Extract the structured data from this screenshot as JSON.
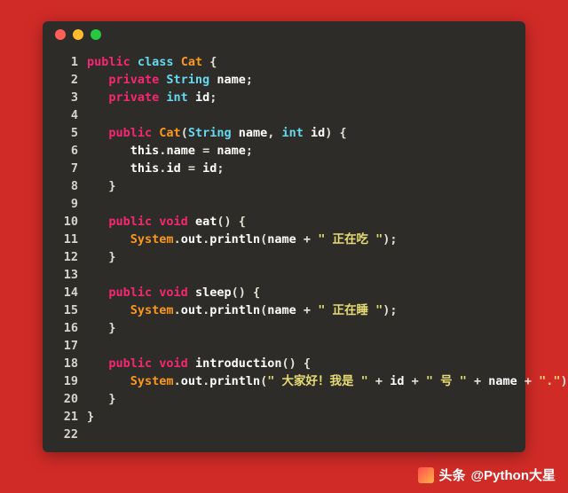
{
  "window": {
    "dots": [
      "red",
      "yellow",
      "green"
    ]
  },
  "code": {
    "lines": [
      [
        {
          "t": "kw",
          "v": "public "
        },
        {
          "t": "type",
          "v": "class "
        },
        {
          "t": "name",
          "v": "Cat "
        },
        {
          "t": "punc",
          "v": "{"
        }
      ],
      [
        {
          "t": "punc",
          "v": "   "
        },
        {
          "t": "kw",
          "v": "private "
        },
        {
          "t": "type",
          "v": "String "
        },
        {
          "t": "id",
          "v": "name"
        },
        {
          "t": "punc",
          "v": ";"
        }
      ],
      [
        {
          "t": "punc",
          "v": "   "
        },
        {
          "t": "kw",
          "v": "private "
        },
        {
          "t": "type",
          "v": "int "
        },
        {
          "t": "id",
          "v": "id"
        },
        {
          "t": "punc",
          "v": ";"
        }
      ],
      [],
      [
        {
          "t": "punc",
          "v": "   "
        },
        {
          "t": "kw",
          "v": "public "
        },
        {
          "t": "name",
          "v": "Cat"
        },
        {
          "t": "punc",
          "v": "("
        },
        {
          "t": "type",
          "v": "String "
        },
        {
          "t": "id",
          "v": "name"
        },
        {
          "t": "punc",
          "v": ", "
        },
        {
          "t": "type",
          "v": "int "
        },
        {
          "t": "id",
          "v": "id"
        },
        {
          "t": "punc",
          "v": ") {"
        }
      ],
      [
        {
          "t": "punc",
          "v": "      "
        },
        {
          "t": "id",
          "v": "this"
        },
        {
          "t": "punc",
          "v": "."
        },
        {
          "t": "id",
          "v": "name"
        },
        {
          "t": "punc",
          "v": " = "
        },
        {
          "t": "id",
          "v": "name"
        },
        {
          "t": "punc",
          "v": ";"
        }
      ],
      [
        {
          "t": "punc",
          "v": "      "
        },
        {
          "t": "id",
          "v": "this"
        },
        {
          "t": "punc",
          "v": "."
        },
        {
          "t": "id",
          "v": "id"
        },
        {
          "t": "punc",
          "v": " = "
        },
        {
          "t": "id",
          "v": "id"
        },
        {
          "t": "punc",
          "v": ";"
        }
      ],
      [
        {
          "t": "punc",
          "v": "   }"
        }
      ],
      [],
      [
        {
          "t": "punc",
          "v": "   "
        },
        {
          "t": "kw",
          "v": "public "
        },
        {
          "t": "kw",
          "v": "void "
        },
        {
          "t": "id",
          "v": "eat"
        },
        {
          "t": "punc",
          "v": "() {"
        }
      ],
      [
        {
          "t": "punc",
          "v": "      "
        },
        {
          "t": "name",
          "v": "System"
        },
        {
          "t": "punc",
          "v": "."
        },
        {
          "t": "id",
          "v": "out"
        },
        {
          "t": "punc",
          "v": "."
        },
        {
          "t": "id",
          "v": "println"
        },
        {
          "t": "punc",
          "v": "("
        },
        {
          "t": "id",
          "v": "name"
        },
        {
          "t": "punc",
          "v": " + "
        },
        {
          "t": "str",
          "v": "\" 正在吃 \""
        },
        {
          "t": "punc",
          "v": ");"
        }
      ],
      [
        {
          "t": "punc",
          "v": "   }"
        }
      ],
      [],
      [
        {
          "t": "punc",
          "v": "   "
        },
        {
          "t": "kw",
          "v": "public "
        },
        {
          "t": "kw",
          "v": "void "
        },
        {
          "t": "id",
          "v": "sleep"
        },
        {
          "t": "punc",
          "v": "() {"
        }
      ],
      [
        {
          "t": "punc",
          "v": "      "
        },
        {
          "t": "name",
          "v": "System"
        },
        {
          "t": "punc",
          "v": "."
        },
        {
          "t": "id",
          "v": "out"
        },
        {
          "t": "punc",
          "v": "."
        },
        {
          "t": "id",
          "v": "println"
        },
        {
          "t": "punc",
          "v": "("
        },
        {
          "t": "id",
          "v": "name"
        },
        {
          "t": "punc",
          "v": " + "
        },
        {
          "t": "str",
          "v": "\" 正在睡 \""
        },
        {
          "t": "punc",
          "v": ");"
        }
      ],
      [
        {
          "t": "punc",
          "v": "   }"
        }
      ],
      [],
      [
        {
          "t": "punc",
          "v": "   "
        },
        {
          "t": "kw",
          "v": "public "
        },
        {
          "t": "kw",
          "v": "void "
        },
        {
          "t": "id",
          "v": "introduction"
        },
        {
          "t": "punc",
          "v": "() {"
        }
      ],
      [
        {
          "t": "punc",
          "v": "      "
        },
        {
          "t": "name",
          "v": "System"
        },
        {
          "t": "punc",
          "v": "."
        },
        {
          "t": "id",
          "v": "out"
        },
        {
          "t": "punc",
          "v": "."
        },
        {
          "t": "id",
          "v": "println"
        },
        {
          "t": "punc",
          "v": "("
        },
        {
          "t": "str",
          "v": "\" 大家好！我是 \""
        },
        {
          "t": "punc",
          "v": " + "
        },
        {
          "t": "id",
          "v": "id"
        },
        {
          "t": "punc",
          "v": " + "
        },
        {
          "t": "str",
          "v": "\" 号 \""
        },
        {
          "t": "punc",
          "v": " + "
        },
        {
          "t": "id",
          "v": "name"
        },
        {
          "t": "punc",
          "v": " + "
        },
        {
          "t": "str",
          "v": "\".\""
        },
        {
          "t": "punc",
          "v": ");"
        }
      ],
      [
        {
          "t": "punc",
          "v": "   }"
        }
      ],
      [
        {
          "t": "punc",
          "v": "}"
        }
      ],
      []
    ]
  },
  "footer": {
    "prefix": "头条 ",
    "handle": "@Python大星"
  }
}
